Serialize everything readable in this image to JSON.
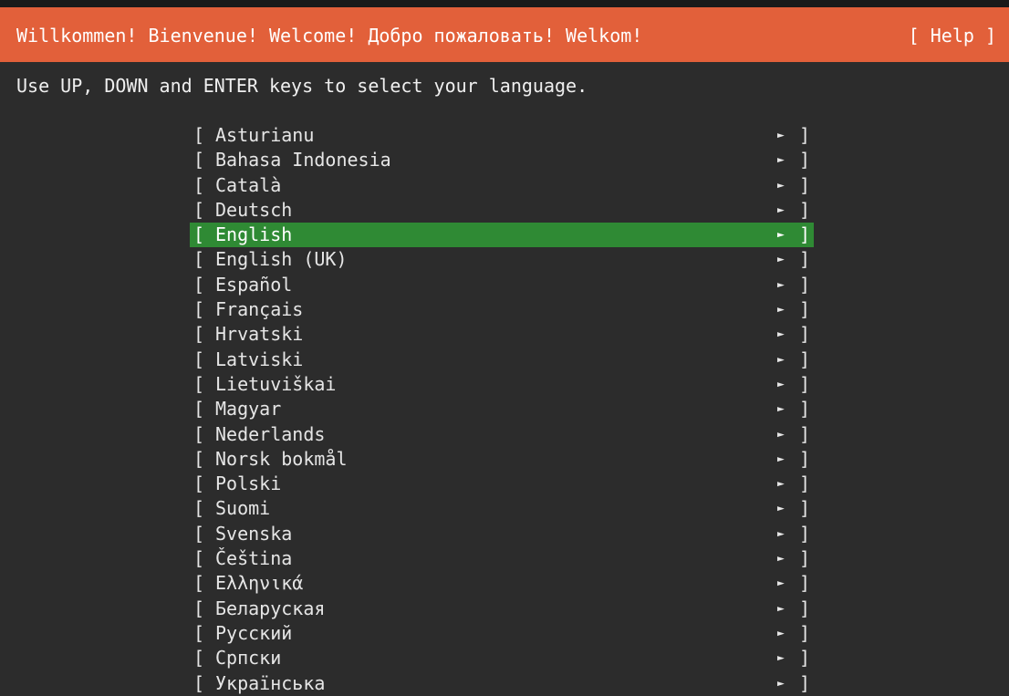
{
  "header": {
    "title": "Willkommen! Bienvenue! Welcome! Добро пожаловать! Welkom!",
    "help_label": "[ Help ]"
  },
  "instructions": "Use UP, DOWN and ENTER keys to select your language.",
  "colors": {
    "header_bg": "#e2603a",
    "background": "#2c2c2c",
    "selected_bg": "#2f8a34"
  },
  "languages": {
    "selected": "English",
    "items": [
      {
        "label": "Asturianu"
      },
      {
        "label": "Bahasa Indonesia"
      },
      {
        "label": "Català"
      },
      {
        "label": "Deutsch"
      },
      {
        "label": "English"
      },
      {
        "label": "English (UK)"
      },
      {
        "label": "Español"
      },
      {
        "label": "Français"
      },
      {
        "label": "Hrvatski"
      },
      {
        "label": "Latviski"
      },
      {
        "label": "Lietuviškai"
      },
      {
        "label": "Magyar"
      },
      {
        "label": "Nederlands"
      },
      {
        "label": "Norsk bokmål"
      },
      {
        "label": "Polski"
      },
      {
        "label": "Suomi"
      },
      {
        "label": "Svenska"
      },
      {
        "label": "Čeština"
      },
      {
        "label": "Ελληνικά"
      },
      {
        "label": "Беларуская"
      },
      {
        "label": "Русский"
      },
      {
        "label": "Српски"
      },
      {
        "label": "Українська"
      }
    ],
    "open_bracket": "[",
    "close_bracket": "]",
    "arrow_glyph": "►"
  }
}
